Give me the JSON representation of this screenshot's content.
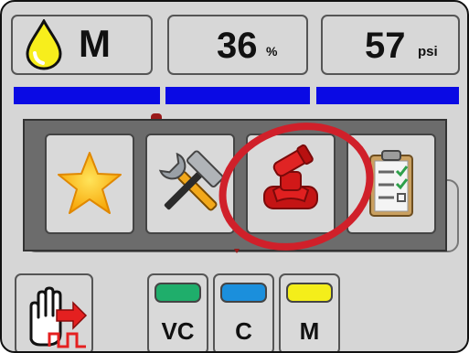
{
  "status": {
    "product": {
      "icon": "oil-drop-icon",
      "label": "M",
      "drop_color": "#f7ee1c"
    },
    "pressure_percent": {
      "value": "36",
      "unit": "%"
    },
    "pressure_psi": {
      "value": "57",
      "unit": "psi"
    },
    "bar_color": "#0a0ae4"
  },
  "menu": {
    "options": [
      {
        "icon": "star-icon"
      },
      {
        "icon": "tools-icon"
      },
      {
        "icon": "nozzle-icon",
        "highlighted": true
      },
      {
        "icon": "checklist-icon"
      }
    ],
    "highlight_color": "#d0202a"
  },
  "bottom": {
    "stop_icon": "hand-stop-icon",
    "sprayers": [
      {
        "label": "VC",
        "color": "#1fae6b"
      },
      {
        "label": "C",
        "color": "#1b8fdc"
      },
      {
        "label": "M",
        "color": "#f4ee1a"
      }
    ]
  }
}
